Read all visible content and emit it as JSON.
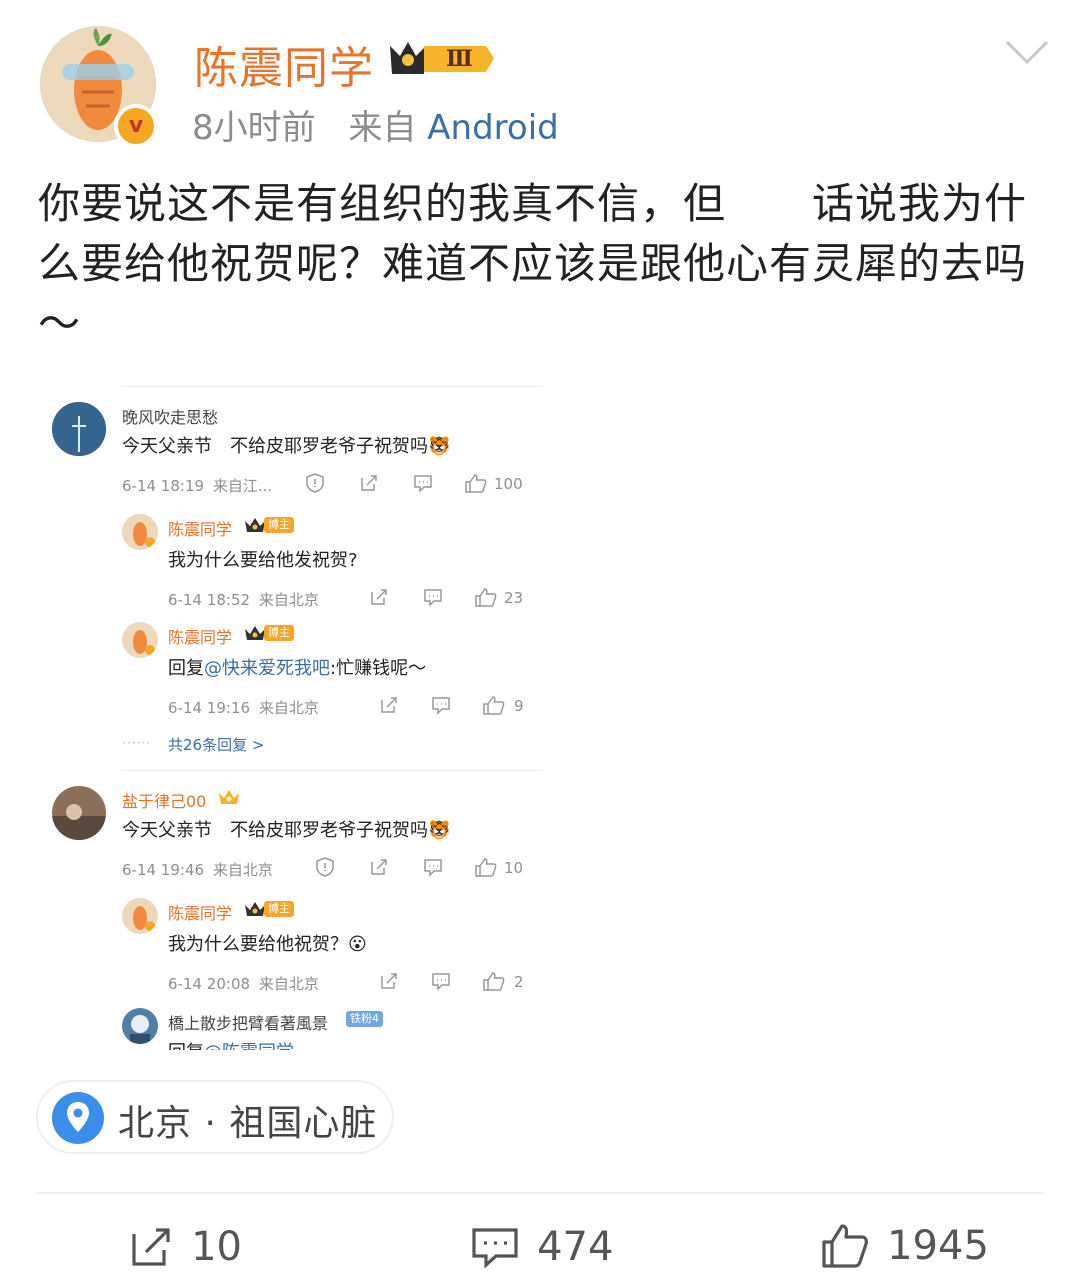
{
  "post": {
    "author": "陈震同学",
    "rank_badge": "Ⅲ",
    "time": "8小时前",
    "from_label": "来自",
    "source": "Android",
    "avatar_badge": "v",
    "text": "你要说这不是有组织的我真不信，但　　话说我为什么要给他祝贺呢？难道不应该是跟他心有灵犀的去吗～"
  },
  "comments": [
    {
      "user": "晚风吹走思愁",
      "text": "今天父亲节　不给皮耶罗老爷子祝贺吗",
      "emoji": "🐯",
      "time": "6-14 18:19",
      "from": "来自江...",
      "likes": "100",
      "replies": [
        {
          "user": "陈震同学",
          "badge": "博主",
          "text": "我为什么要给他发祝贺?",
          "time": "6-14 18:52",
          "from": "来自北京",
          "likes": "23"
        },
        {
          "user": "陈震同学",
          "badge": "博主",
          "prefix": "回复",
          "mention": "@快来爱死我吧",
          "text": ":忙赚钱呢～",
          "time": "6-14 19:16",
          "from": "来自北京",
          "likes": "9"
        }
      ],
      "more_replies": "共26条回复 >"
    },
    {
      "user": "盐于律己00",
      "text": "今天父亲节　不给皮耶罗老爷子祝贺吗",
      "emoji": "🐯",
      "time": "6-14 19:46",
      "from": "来自北京",
      "likes": "10",
      "replies": [
        {
          "user": "陈震同学",
          "badge": "博主",
          "text": "我为什么要给他祝贺？",
          "emoji": "😮",
          "time": "6-14 20:08",
          "from": "来自北京",
          "likes": "2"
        },
        {
          "user": "橋上散步把臂看著風景",
          "badge": "铁粉4",
          "prefix": "回复",
          "mention": "@陈震同学",
          "text": "..."
        }
      ]
    }
  ],
  "location": "北京 · 祖国心脏",
  "actions": {
    "reposts": "10",
    "comments": "474",
    "likes": "1945"
  },
  "colors": {
    "accent": "#e8732a",
    "link": "#3a6ea5",
    "location_pin": "#3b8eea"
  }
}
